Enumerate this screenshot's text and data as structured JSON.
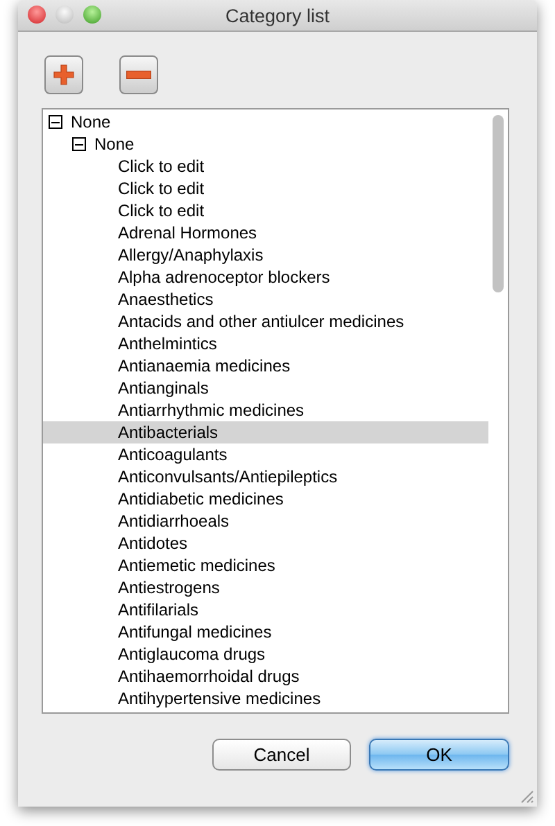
{
  "window": {
    "title": "Category list"
  },
  "toolbar": [
    {
      "kind": "add"
    },
    {
      "kind": "remove"
    }
  ],
  "tree": [
    {
      "label": "None",
      "expanded": true,
      "selected": false,
      "children": [
        {
          "label": "None",
          "expanded": true,
          "selected": false,
          "children": [
            {
              "label": "Click to edit",
              "selected": false
            },
            {
              "label": "Click to edit",
              "selected": false
            },
            {
              "label": "Click to edit",
              "selected": false
            },
            {
              "label": "Adrenal Hormones",
              "selected": false
            },
            {
              "label": "Allergy/Anaphylaxis",
              "selected": false
            },
            {
              "label": "Alpha adrenoceptor blockers",
              "selected": false
            },
            {
              "label": "Anaesthetics",
              "selected": false
            },
            {
              "label": "Antacids and other antiulcer medicines",
              "selected": false
            },
            {
              "label": "Anthelmintics",
              "selected": false
            },
            {
              "label": "Antianaemia medicines",
              "selected": false
            },
            {
              "label": "Antianginals",
              "selected": false
            },
            {
              "label": "Antiarrhythmic medicines",
              "selected": false
            },
            {
              "label": "Antibacterials",
              "selected": true
            },
            {
              "label": "Anticoagulants",
              "selected": false
            },
            {
              "label": "Anticonvulsants/Antiepileptics",
              "selected": false
            },
            {
              "label": "Antidiabetic medicines",
              "selected": false
            },
            {
              "label": "Antidiarrhoeals",
              "selected": false
            },
            {
              "label": "Antidotes",
              "selected": false
            },
            {
              "label": "Antiemetic medicines",
              "selected": false
            },
            {
              "label": "Antiestrogens",
              "selected": false
            },
            {
              "label": "Antifilarials",
              "selected": false
            },
            {
              "label": "Antifungal medicines",
              "selected": false
            },
            {
              "label": "Antiglaucoma drugs",
              "selected": false
            },
            {
              "label": "Antihaemorrhoidal drugs",
              "selected": false
            },
            {
              "label": "Antihypertensive medicines",
              "selected": false
            }
          ]
        }
      ]
    }
  ],
  "buttons": [
    {
      "label": "Cancel",
      "default": false
    },
    {
      "label": "OK",
      "default": true
    }
  ]
}
